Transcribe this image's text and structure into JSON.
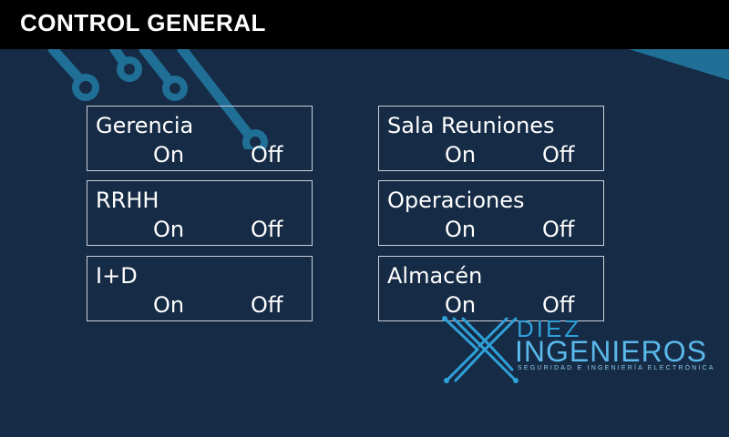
{
  "header": {
    "title": "CONTROL GENERAL"
  },
  "zones": [
    {
      "name": "Gerencia",
      "on_label": "On",
      "off_label": "Off"
    },
    {
      "name": "RRHH",
      "on_label": "On",
      "off_label": "Off"
    },
    {
      "name": "I+D",
      "on_label": "On",
      "off_label": "Off"
    },
    {
      "name": "Sala Reuniones",
      "on_label": "On",
      "off_label": "Off"
    },
    {
      "name": "Operaciones",
      "on_label": "On",
      "off_label": "Off"
    },
    {
      "name": "Almacén",
      "on_label": "On",
      "off_label": "Off"
    }
  ],
  "logo": {
    "line1": "DIEZ",
    "line2": "INGENIEROS",
    "tagline": "SEGURIDAD E INGENIERÍA ELECTRÓNICA"
  },
  "colors": {
    "background": "#162b45",
    "header": "#000000",
    "circuit": "#1f6f96",
    "logo_accent": "#2fa0d8"
  }
}
